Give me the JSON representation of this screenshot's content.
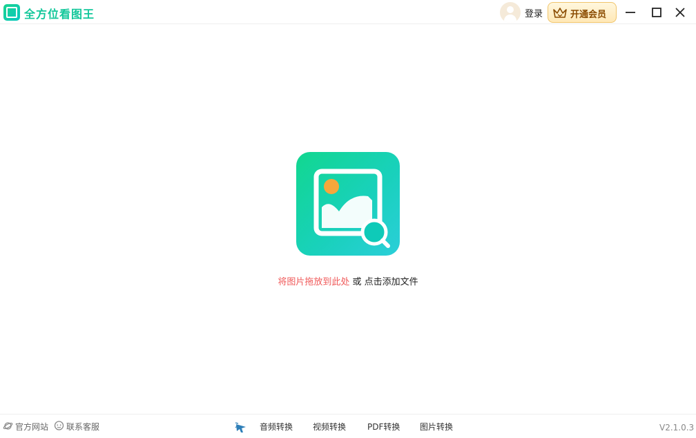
{
  "app": {
    "title": "全方位看图王",
    "accent_color": "#12c79a"
  },
  "header": {
    "login_label": "登录",
    "vip_label": "开通会员",
    "window_controls": [
      "minimize-icon",
      "maximize-icon",
      "close-icon"
    ]
  },
  "drop_zone": {
    "drag_text": "将图片拖放到此处",
    "or_text": "或",
    "click_text": "点击添加文件",
    "drag_color": "#f05a5a"
  },
  "footer": {
    "site_label": "官方网站",
    "service_label": "联系客服",
    "tools": [
      "音频转换",
      "视频转换",
      "PDF转换",
      "图片转换"
    ],
    "version": "V2.1.0.3"
  }
}
